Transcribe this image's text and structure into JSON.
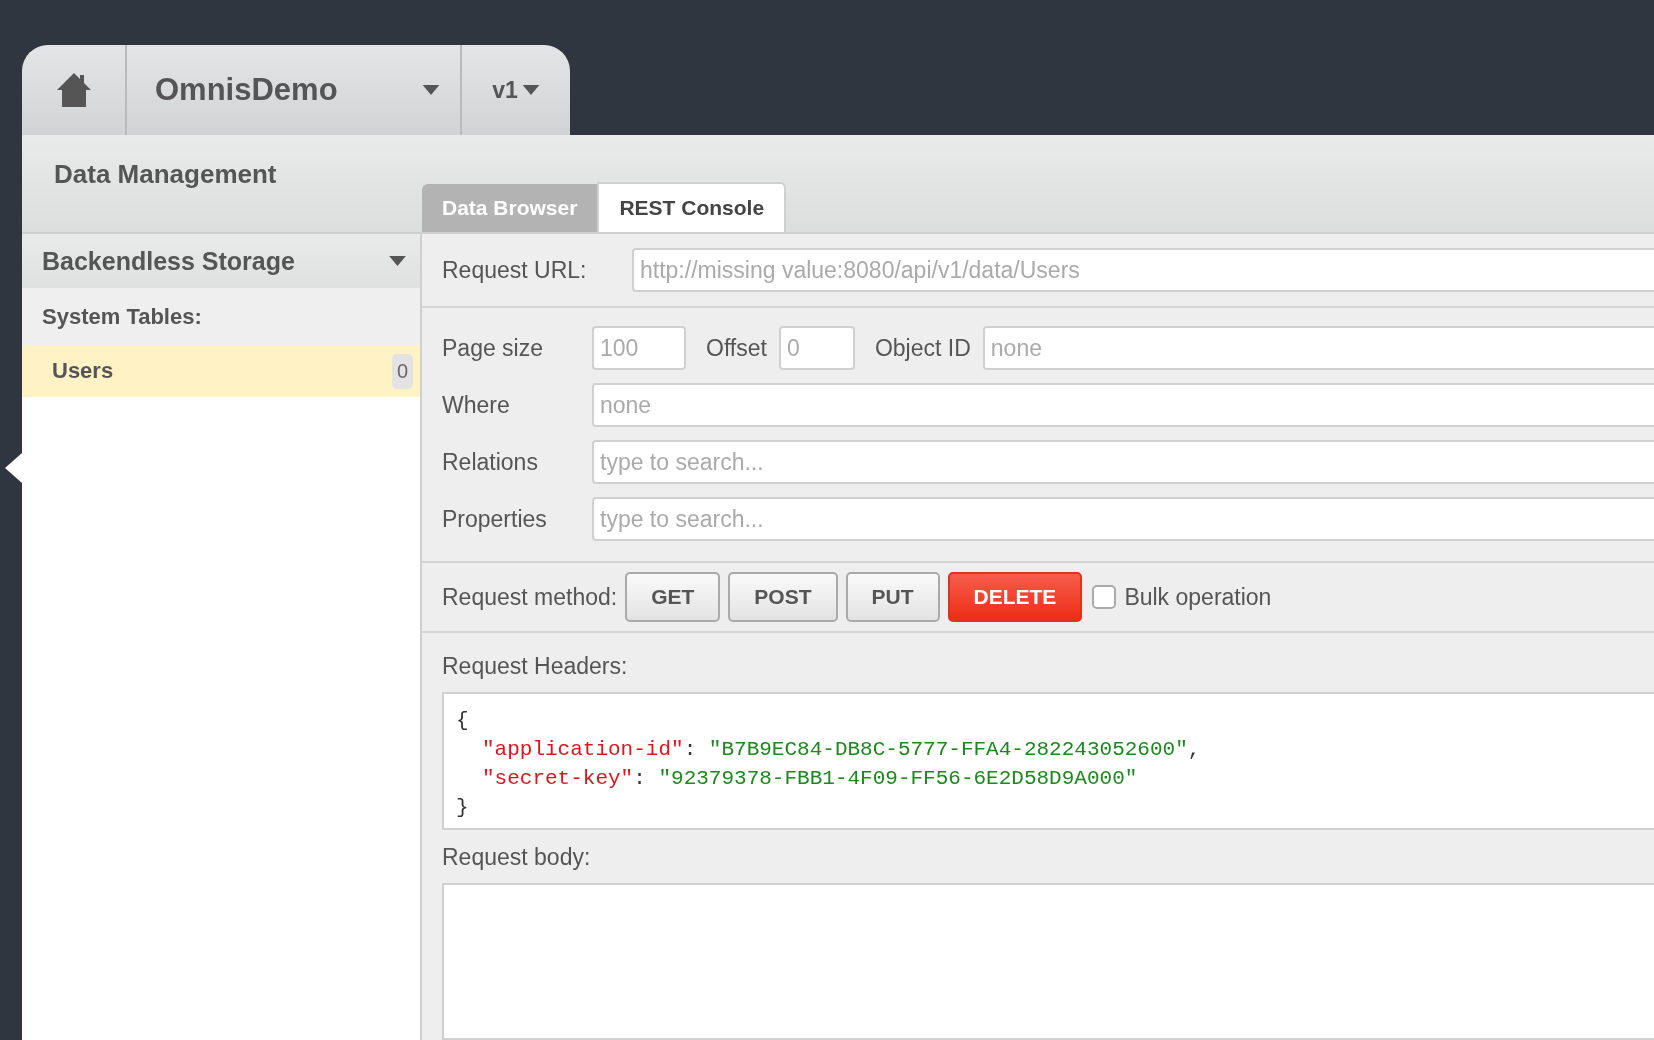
{
  "app_bar": {
    "app_name": "OmnisDemo",
    "version": "v1"
  },
  "page_title": "Data Management",
  "tabs": [
    {
      "label": "Data Browser",
      "selected": false
    },
    {
      "label": "REST Console",
      "selected": true
    }
  ],
  "sidebar": {
    "section": "Backendless Storage",
    "group": "System Tables:",
    "items": [
      {
        "label": "Users",
        "count": "0",
        "selected": true
      }
    ]
  },
  "request_url": {
    "label": "Request URL:",
    "placeholder": "http://missing value:8080/api/v1/data/Users"
  },
  "query": {
    "page_size": {
      "label": "Page size",
      "placeholder": "100"
    },
    "offset": {
      "label": "Offset",
      "placeholder": "0"
    },
    "object_id": {
      "label": "Object ID",
      "placeholder": "none"
    },
    "where": {
      "label": "Where",
      "placeholder": "none"
    },
    "relations": {
      "label": "Relations",
      "placeholder": "type to search..."
    },
    "properties": {
      "label": "Properties",
      "placeholder": "type to search..."
    }
  },
  "request_method": {
    "label": "Request method:",
    "methods": [
      {
        "label": "GET",
        "selected": false
      },
      {
        "label": "POST",
        "selected": false
      },
      {
        "label": "PUT",
        "selected": false
      },
      {
        "label": "DELETE",
        "selected": true
      }
    ],
    "bulk": {
      "label": "Bulk operation",
      "checked": false
    }
  },
  "request_headers": {
    "label": "Request Headers:",
    "open": "{",
    "close": "}",
    "entries": [
      {
        "key": "\"application-id\"",
        "value": "\"B7B9EC84-DB8C-5777-FFA4-282243052600\"",
        "separator": ",",
        "colon": ":"
      },
      {
        "key": "\"secret-key\"",
        "value": "\"92379378-FBB1-4F09-FF56-6E2D58D9A000\"",
        "colon": ":"
      }
    ]
  },
  "request_body": {
    "label": "Request body:"
  }
}
